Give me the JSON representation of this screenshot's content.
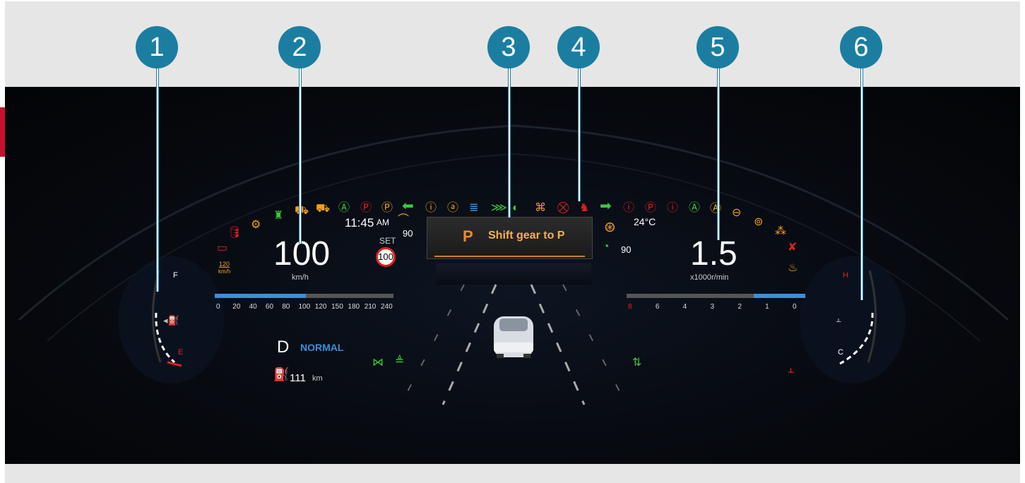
{
  "callouts": [
    "1",
    "2",
    "3",
    "4",
    "5",
    "6"
  ],
  "clock": {
    "time": "11:45",
    "ampm": "AM"
  },
  "outside_temp": "24°C",
  "speed": {
    "value": "100",
    "unit": "km/h",
    "set_label": "SET",
    "limit_sign": "100",
    "scale": [
      "0",
      "20",
      "40",
      "60",
      "80",
      "100",
      "120",
      "150",
      "180",
      "210",
      "240"
    ],
    "fill_fraction": 0.51
  },
  "speed_limit_indicator": {
    "value": "120",
    "unit": "km/h"
  },
  "curve_speed": "90",
  "cruise_speed": "90",
  "tach": {
    "value": "1.5",
    "unit": "x1000r/min",
    "scale": [
      "8",
      "6",
      "4",
      "3",
      "2",
      "1",
      "0"
    ],
    "fill_fraction": 0.29
  },
  "message": {
    "letter": "P",
    "text": "Shift gear to P"
  },
  "gear": {
    "position": "D",
    "mode": "NORMAL"
  },
  "range": {
    "value": "111",
    "unit": "km"
  },
  "fuel_gauge": {
    "full": "F",
    "empty": "E"
  },
  "temp_gauge": {
    "hot": "H",
    "cold": "C"
  },
  "colors": {
    "callout": "#1b7ea1",
    "warning_red": "#e02020",
    "amber": "#f0a020",
    "green": "#3cc83c",
    "blue": "#3a8fd9"
  }
}
